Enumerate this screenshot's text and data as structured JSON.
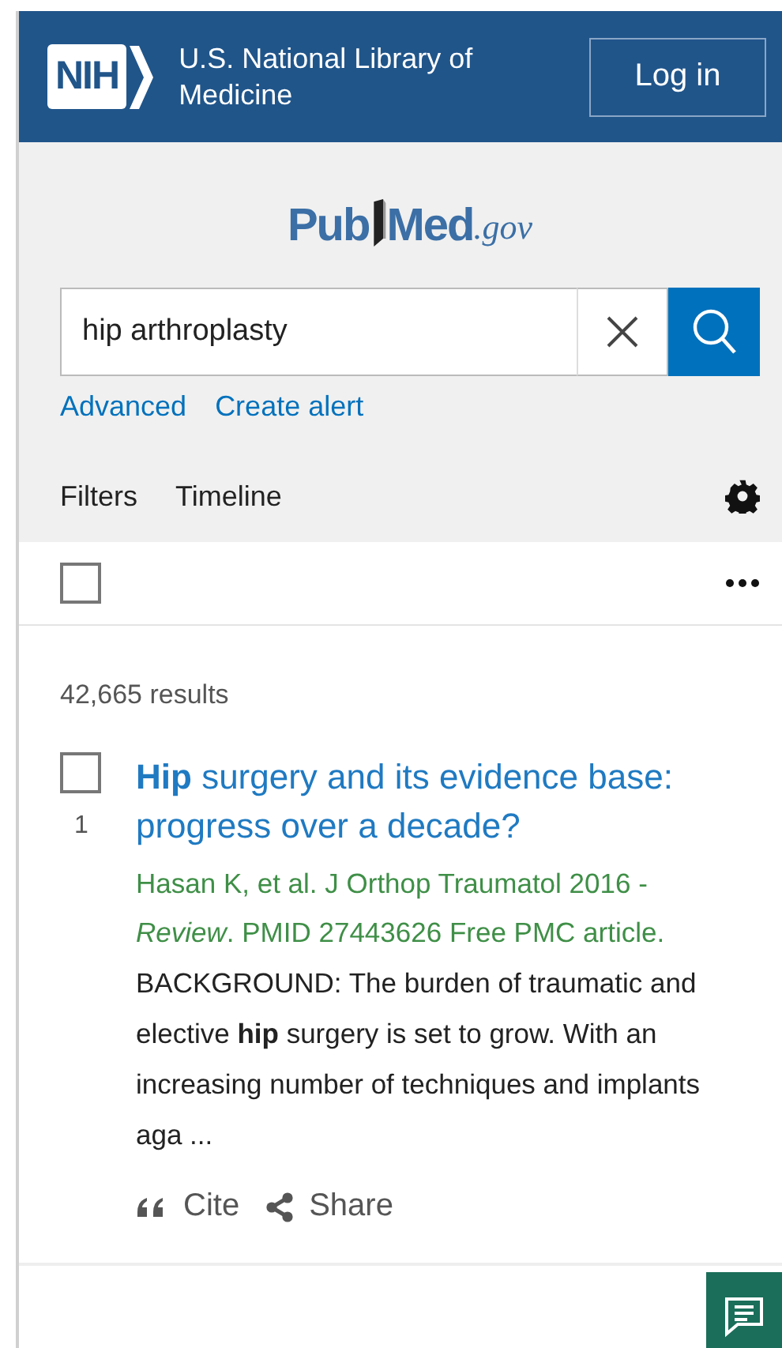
{
  "header": {
    "agency": "NIH",
    "title": "U.S. National Library of Medicine",
    "login": "Log in"
  },
  "logo": {
    "first": "Pub",
    "second": "Med",
    "suffix": ".gov"
  },
  "search": {
    "value": "hip arthroplasty"
  },
  "links": [
    "Advanced",
    "Create alert"
  ],
  "view_links": [
    "Filters",
    "Timeline"
  ],
  "select_all": {
    "checked": false
  },
  "results_count": "42,665 results",
  "results": [
    {
      "number": "1",
      "checked": false,
      "title": "**Hip** surgery and its evidence base: progress over a decade?",
      "citation": "Hasan K, et al. J Orthop Traumatol 2016 - *Review*. PMID 27443626 Free PMC article.",
      "snippet": "BACKGROUND: The burden of traumatic and elective **hip** surgery is set to grow. With an increasing number of techniques and implants aga ...",
      "actions": [
        {
          "kind": "cite",
          "label": "Cite"
        },
        {
          "kind": "share",
          "label": "Share"
        }
      ]
    }
  ]
}
